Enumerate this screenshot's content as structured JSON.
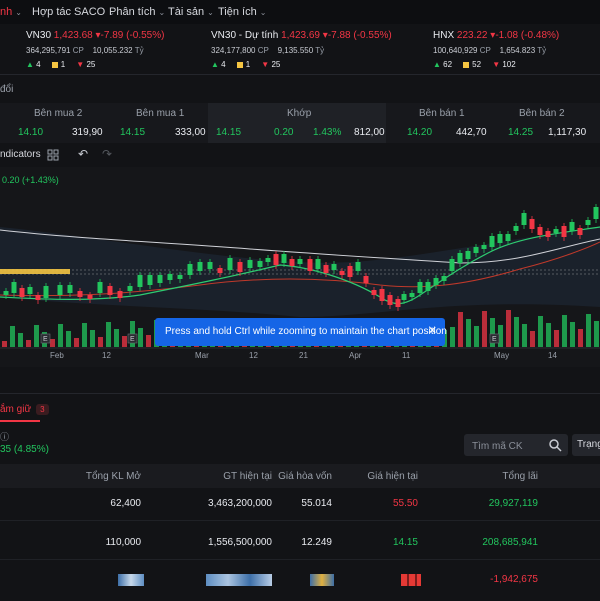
{
  "nav": {
    "items": [
      {
        "label": "nh",
        "active": true
      },
      {
        "label": "Hợp tác SACO"
      },
      {
        "label": "Phân tích"
      },
      {
        "label": "Tài sản"
      },
      {
        "label": "Tiện ích"
      }
    ]
  },
  "indices": [
    {
      "name": "VN30",
      "value": "1,423.68",
      "change": "-7.89 (-0.55%)",
      "volume": "364,295,791",
      "vol_unit": "CP",
      "gt": "10,055.232",
      "gt_unit": "Tỷ",
      "up": "4",
      "flat": "1",
      "down": "25"
    },
    {
      "name": "VN30 - Dự tính",
      "value": "1,423.69",
      "change": "-7.88 (-0.55%)",
      "volume": "324,177,800",
      "vol_unit": "CP",
      "gt": "9,135.550",
      "gt_unit": "Tỷ",
      "up": "4",
      "flat": "1",
      "down": "25"
    },
    {
      "name": "HNX",
      "value": "223.22",
      "change": "-1.08 (-0.48%)",
      "volume": "100,640,929",
      "vol_unit": "CP",
      "gt": "1,654.823",
      "gt_unit": "Tỷ",
      "up": "62",
      "flat": "52",
      "down": "102"
    }
  ],
  "sub_label": "đổi",
  "order_book": {
    "headers": {
      "buy2": "Bên mua 2",
      "buy1": "Bên mua 1",
      "match": "Khớp",
      "sell1": "Bên bán 1",
      "sell2": "Bên bán 2"
    },
    "buy2": {
      "price": "14.10",
      "vol": "319,90"
    },
    "buy1": {
      "price": "14.15",
      "vol": "333,00"
    },
    "match": {
      "price": "14.15",
      "change": "0.20",
      "pct": "1.43%",
      "vol": "812,00"
    },
    "sell1": {
      "price": "14.20",
      "vol": "442,70"
    },
    "sell2": {
      "price": "14.25",
      "vol": "1,117,30"
    }
  },
  "toolbar": {
    "indicators": "ndicators"
  },
  "chart": {
    "change_label": "0.20 (+1.43%)",
    "x_labels": [
      "Feb",
      "12",
      "Mar",
      "12",
      "21",
      "Apr",
      "11",
      "May",
      "14"
    ],
    "event_marker": "E",
    "colors": {
      "up": "#22c55e",
      "down": "#f23645",
      "ma_white": "#d0d2d8",
      "ma_red": "#c0392b",
      "ma_green": "#2ecc71",
      "price_line": "#f5c542"
    }
  },
  "chart_data": {
    "type": "candlestick",
    "x_ticks": [
      "Feb",
      "12",
      "Mar",
      "12",
      "21",
      "Apr",
      "11",
      "May",
      "14"
    ],
    "description_series": [
      "candles",
      "volume",
      "moving averages"
    ]
  },
  "toast": {
    "message": "Press and hold Ctrl while zooming to maintain the chart position"
  },
  "holdings": {
    "tab_label": "ắm giữ",
    "tab_count": "3",
    "info_icon_label": "ⓘ",
    "summary_value": "35 (4.85%)",
    "search_placeholder": "Tìm mã CK",
    "status_label": "Trạng",
    "columns": [
      "Tổng KL Mở",
      "GT hiện tại",
      "Giá hòa vốn",
      "Giá hiện tại",
      "Tổng lãi"
    ],
    "rows": [
      {
        "kl": "62,400",
        "gt": "3,463,200,000",
        "hoa_von": "55.014",
        "hien_tai": "55.50",
        "lai": "29,927,119"
      },
      {
        "kl": "110,000",
        "gt": "1,556,500,000",
        "hoa_von": "12.249",
        "hien_tai": "14.15",
        "lai": "208,685,941"
      },
      {
        "kl": "",
        "gt": "",
        "hoa_von": "",
        "hien_tai": "",
        "lai": "-1,942,675"
      }
    ]
  }
}
